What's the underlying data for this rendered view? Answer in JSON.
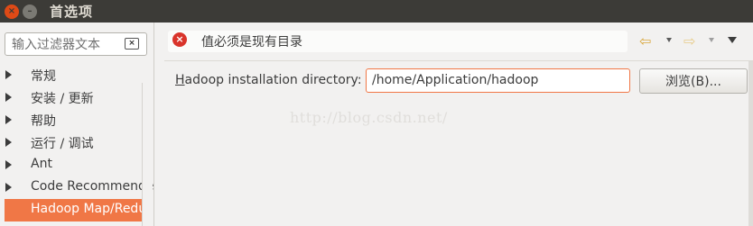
{
  "window": {
    "title": "首选项",
    "close_glyph": "×",
    "min_glyph": "–"
  },
  "sidebar": {
    "filter_placeholder": "输入过滤器文本",
    "clear_glyph": "×",
    "items": [
      {
        "label": "常规",
        "expandable": true,
        "selected": false
      },
      {
        "label": "安装 / 更新",
        "expandable": true,
        "selected": false
      },
      {
        "label": "帮助",
        "expandable": true,
        "selected": false
      },
      {
        "label": "运行 / 调试",
        "expandable": true,
        "selected": false
      },
      {
        "label": "Ant",
        "expandable": true,
        "selected": false
      },
      {
        "label": "Code Recommenders",
        "expandable": true,
        "selected": false
      },
      {
        "label": "Hadoop Map/Reduce",
        "expandable": false,
        "selected": true
      }
    ]
  },
  "header": {
    "message": "值必须是现有目录",
    "error_glyph": "×",
    "back_glyph": "⇦",
    "forward_glyph": "⇨"
  },
  "form": {
    "directory_label_accel": "H",
    "directory_label_rest": "adoop installation directory:",
    "directory_value": "/home/Application/hadoop",
    "browse_label": "浏览(B)..."
  },
  "watermark": "http://blog.csdn.net/",
  "colors": {
    "accent": "#f07746",
    "titlebar": "#3c3b37",
    "error": "#d9342b",
    "nav_arrow": "#d9a73c"
  }
}
